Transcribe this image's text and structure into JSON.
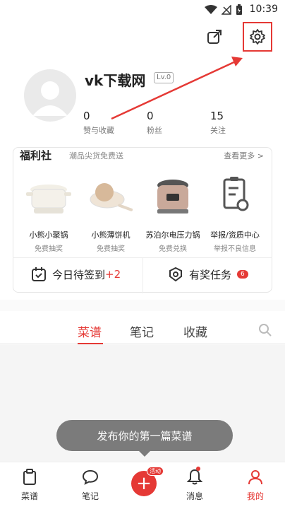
{
  "status": {
    "time": "10:39"
  },
  "profile": {
    "username": "vk下载网",
    "level": "Lv.0",
    "stats": [
      {
        "num": "0",
        "label": "赞与收藏"
      },
      {
        "num": "0",
        "label": "粉丝"
      },
      {
        "num": "15",
        "label": "关注"
      }
    ]
  },
  "welfare": {
    "title": "福利社",
    "subtitle": "潮品尖货免费送",
    "more": "查看更多 >",
    "products": [
      {
        "name": "小熊小聚锅",
        "sub": "免费抽奖"
      },
      {
        "name": "小熊薄饼机",
        "sub": "免费抽奖"
      },
      {
        "name": "苏泊尔电压力锅",
        "sub": "免费兑换"
      },
      {
        "name": "举报/资质中心",
        "sub": "举报不良信息"
      }
    ],
    "signin": {
      "label": "今日待签到",
      "bonus": "+2"
    },
    "tasks": {
      "label": "有奖任务",
      "count": "6"
    }
  },
  "tabs": [
    "菜谱",
    "笔记",
    "收藏"
  ],
  "tooltip": "发布你的第一篇菜谱",
  "nav": {
    "items": [
      "菜谱",
      "笔记",
      "消息",
      "我的"
    ],
    "fab_tag": "活动"
  },
  "colors": {
    "accent": "#e53935"
  }
}
